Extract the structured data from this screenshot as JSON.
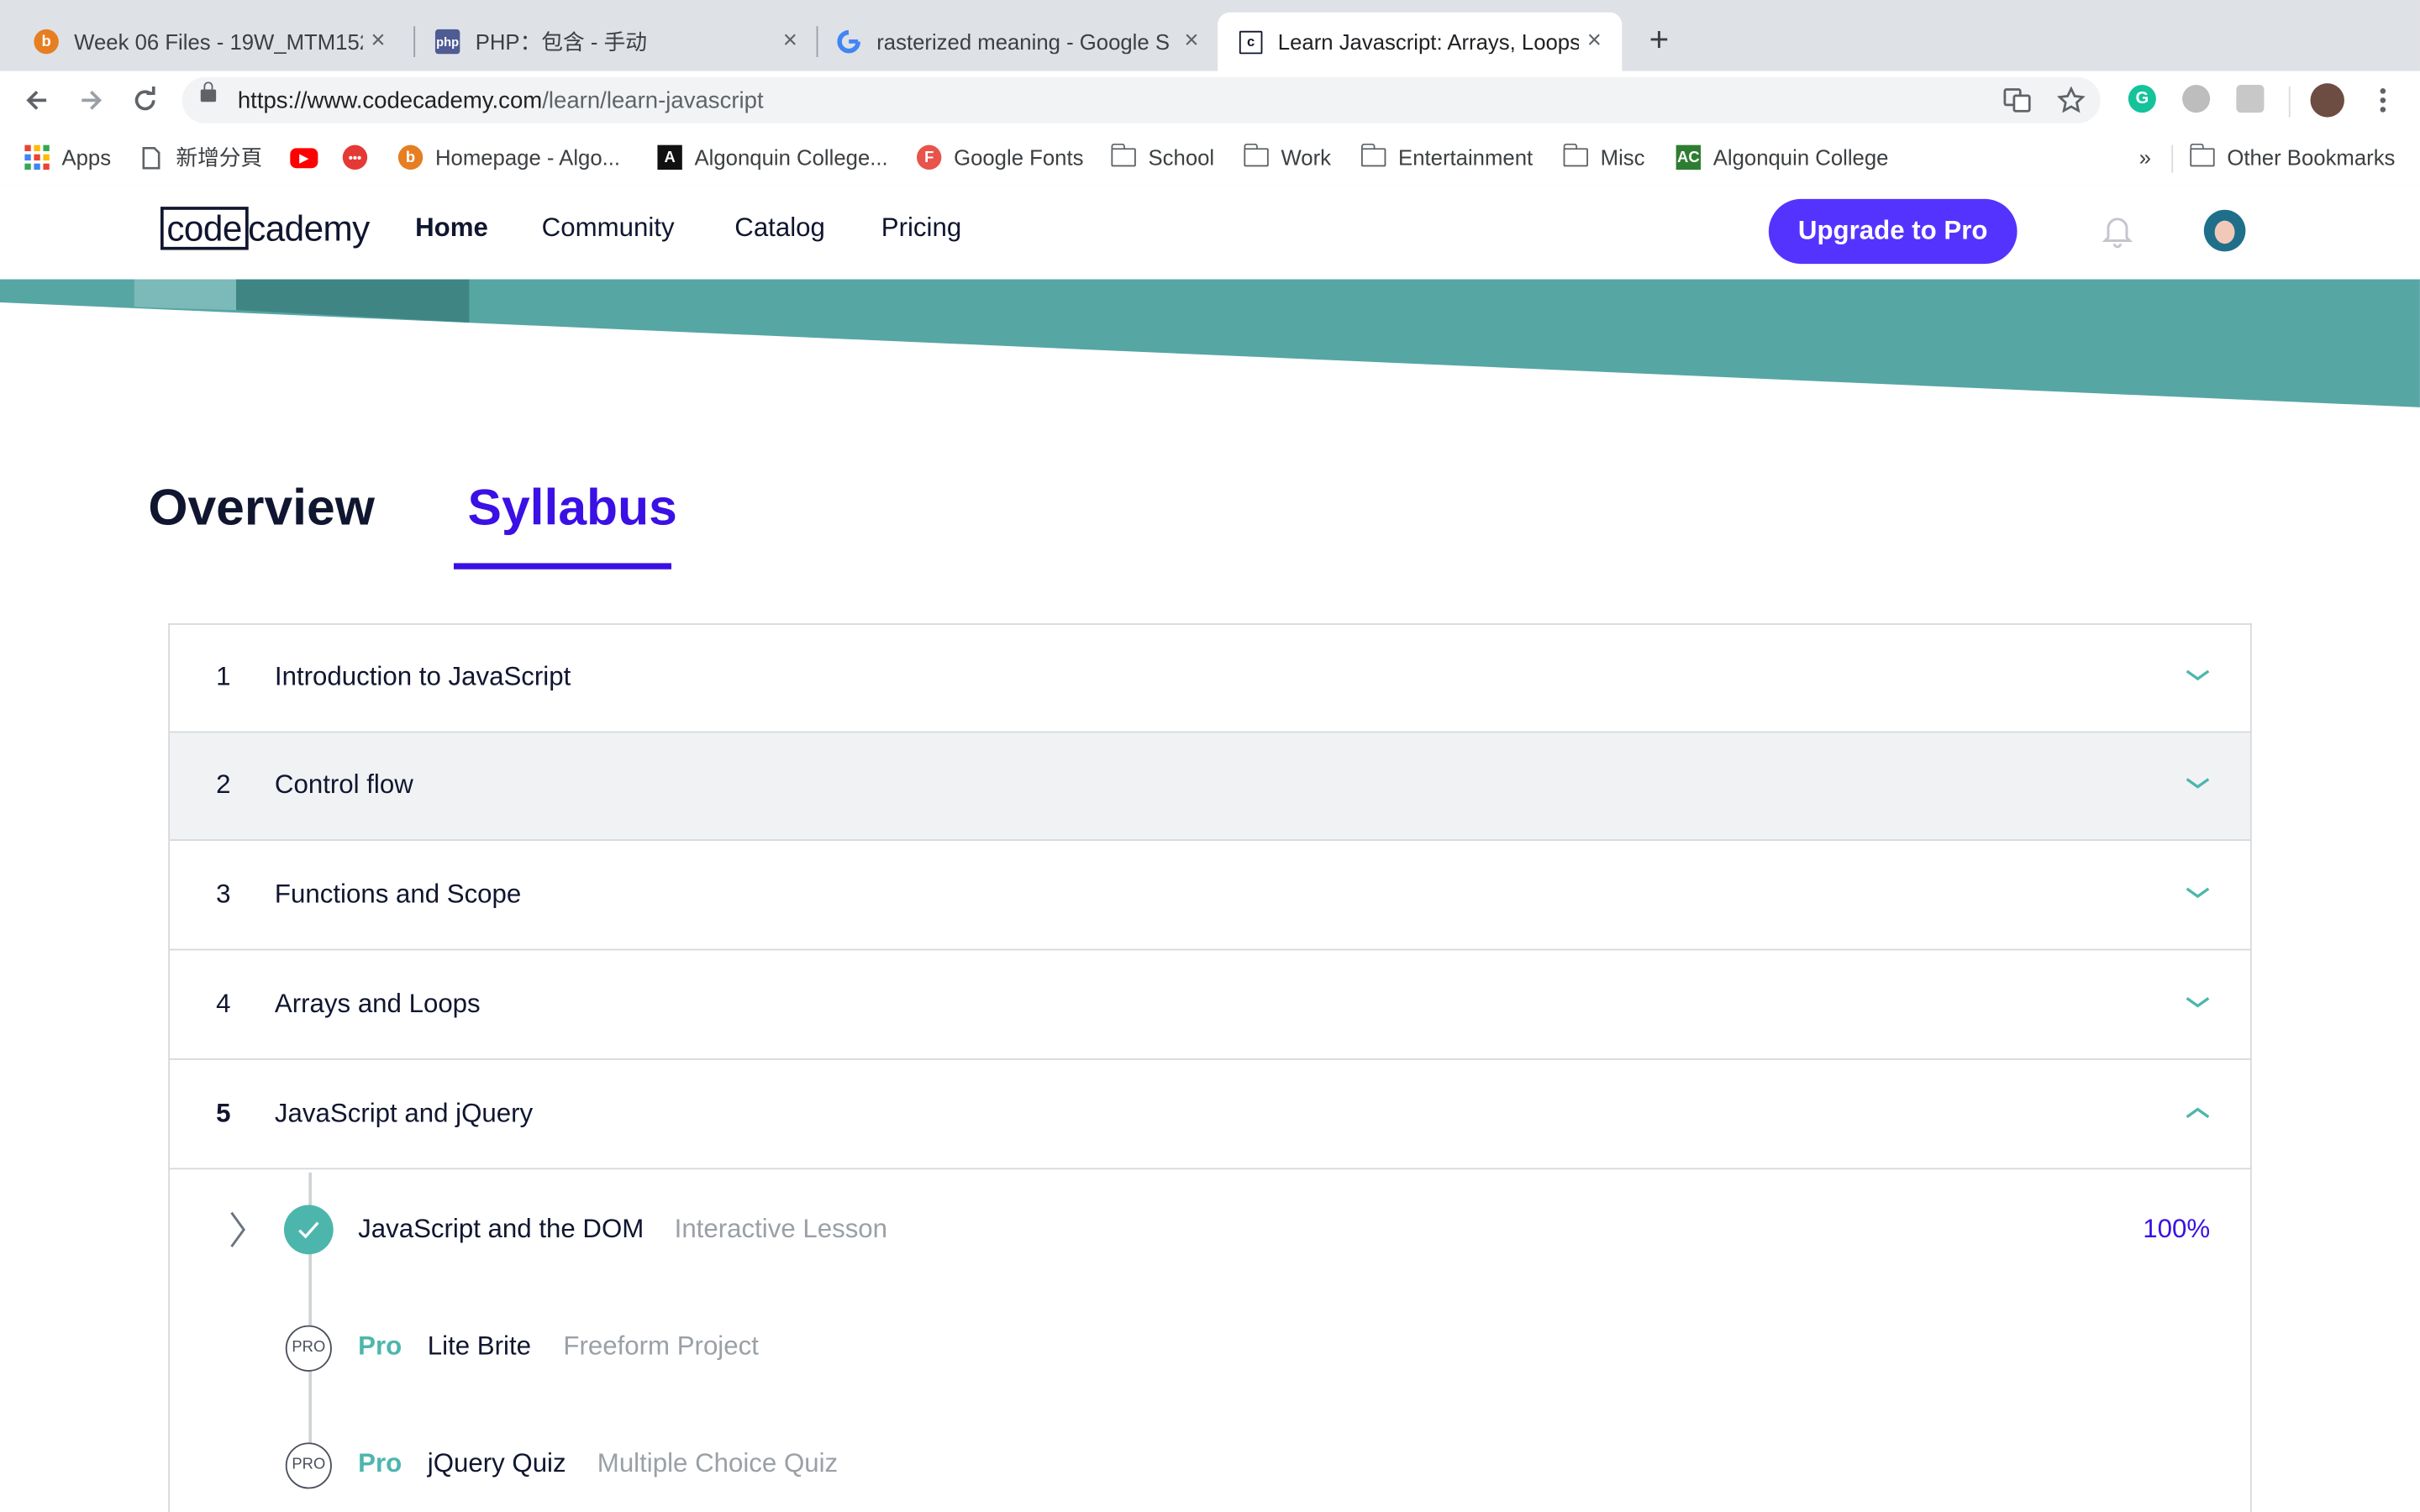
{
  "browser": {
    "tabs": [
      {
        "title": "Week 06 Files - 19W_MTM152",
        "favicon": "brightspace-icon"
      },
      {
        "title": "PHP：包含 - 手动",
        "favicon": "php-icon"
      },
      {
        "title": "rasterized meaning - Google S",
        "favicon": "google-icon"
      },
      {
        "title": "Learn Javascript: Arrays, Loops",
        "favicon": "codecademy-icon",
        "active": true
      }
    ],
    "close_glyph": "×",
    "new_tab_glyph": "+",
    "url_host": "https://www.codecademy.com",
    "url_path": "/learn/learn-javascript",
    "bookmarks": [
      {
        "label": "Apps",
        "icon": "apps-grid-icon"
      },
      {
        "label": "新增分頁",
        "icon": "page-icon"
      },
      {
        "label": "",
        "icon": "youtube-icon"
      },
      {
        "label": "",
        "icon": "chat-icon"
      },
      {
        "label": "Homepage - Algo...",
        "icon": "brightspace-icon"
      },
      {
        "label": "Algonquin College...",
        "icon": "algonquin-icon"
      },
      {
        "label": "Google Fonts",
        "icon": "google-fonts-icon"
      },
      {
        "label": "School",
        "icon": "folder-icon"
      },
      {
        "label": "Work",
        "icon": "folder-icon"
      },
      {
        "label": "Entertainment",
        "icon": "folder-icon"
      },
      {
        "label": "Misc",
        "icon": "folder-icon"
      },
      {
        "label": "Algonquin College",
        "icon": "algonquin-ac-icon"
      }
    ],
    "overflow_glyph": "»",
    "other_bookmarks": "Other Bookmarks"
  },
  "site": {
    "logo_boxed": "code",
    "logo_rest": "cademy",
    "nav": {
      "home": "Home",
      "community": "Community",
      "catalog": "Catalog",
      "pricing": "Pricing"
    },
    "upgrade_label": "Upgrade to Pro"
  },
  "page_tabs": {
    "overview": "Overview",
    "syllabus": "Syllabus",
    "active": "Syllabus"
  },
  "syllabus": {
    "modules": [
      {
        "num": "1",
        "title": "Introduction to JavaScript",
        "expanded": false
      },
      {
        "num": "2",
        "title": "Control flow",
        "expanded": false
      },
      {
        "num": "3",
        "title": "Functions and Scope",
        "expanded": false
      },
      {
        "num": "4",
        "title": "Arrays and Loops",
        "expanded": false
      },
      {
        "num": "5",
        "title": "JavaScript and jQuery",
        "expanded": true
      }
    ],
    "lessons": [
      {
        "title": "JavaScript and the DOM",
        "type": "Interactive Lesson",
        "progress": "100%",
        "completed": true
      },
      {
        "pro_tag": "Pro",
        "badge": "PRO",
        "title": "Lite Brite",
        "type": "Freeform Project"
      },
      {
        "pro_tag": "Pro",
        "badge": "PRO",
        "title": "jQuery Quiz",
        "type": "Multiple Choice Quiz"
      }
    ]
  },
  "colors": {
    "accent": "#3a10e5",
    "teal": "#4db6ac",
    "upgrade": "#5533ff",
    "banner": "#56a6a4"
  }
}
